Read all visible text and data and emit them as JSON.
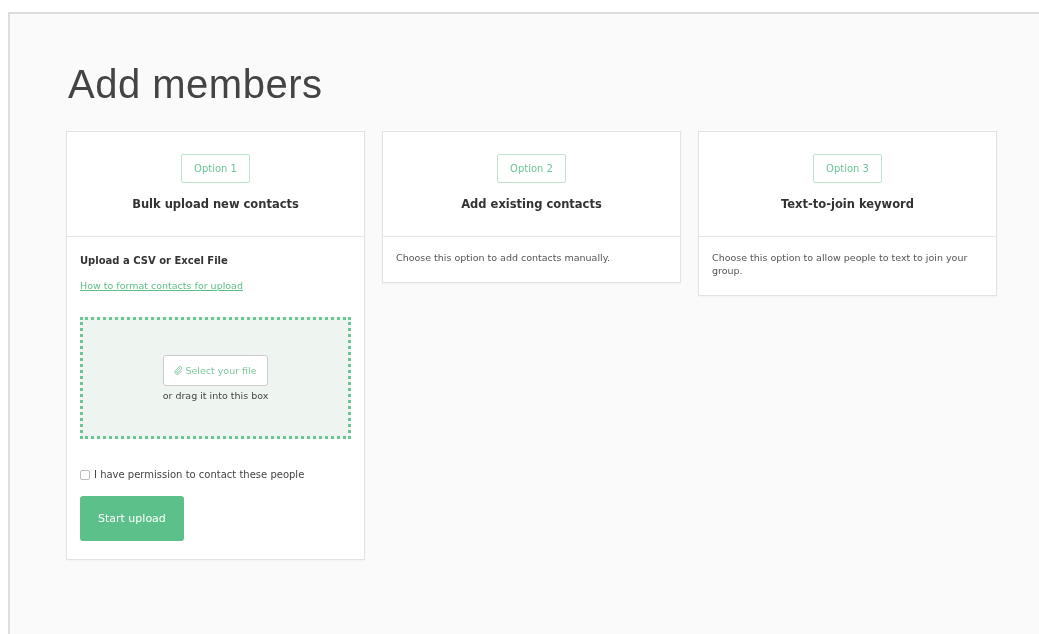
{
  "title": "Add members",
  "options": [
    {
      "kind": "upload",
      "badge": "Option 1",
      "heading": "Bulk upload new contacts",
      "upload_label": "Upload a CSV or Excel File",
      "help_link": "How to format contacts for upload",
      "select_button": "Select your file",
      "drop_hint": "or drag it into this box",
      "permission": {
        "label": "I have permission to contact these people",
        "checked": false
      },
      "submit": "Start upload"
    },
    {
      "kind": "description",
      "badge": "Option 2",
      "heading": "Add existing contacts",
      "description": "Choose this option to add contacts manually."
    },
    {
      "kind": "description",
      "badge": "Option 3",
      "heading": "Text-to-join keyword",
      "description": "Choose this option to allow people to text to join your group."
    }
  ]
}
